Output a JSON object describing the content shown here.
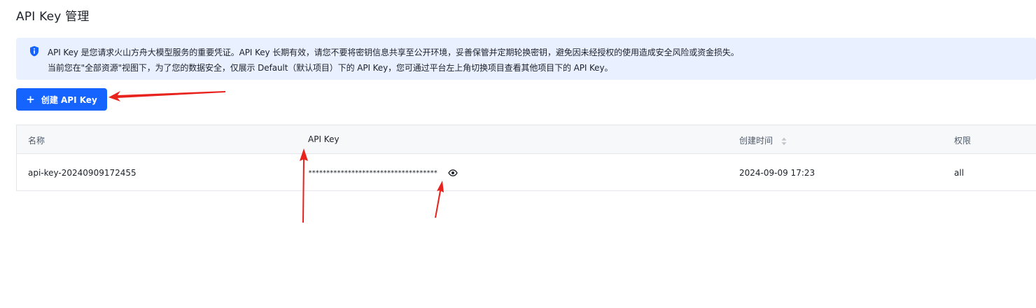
{
  "page": {
    "title": "API Key 管理"
  },
  "notice": {
    "icon": "shield-info-icon",
    "line1": "API Key 是您请求火山方舟大模型服务的重要凭证。API Key 长期有效，请您不要将密钥信息共享至公开环境，妥善保管并定期轮换密钥，避免因未经授权的使用造成安全风险或资金损失。",
    "line2": "当前您在\"全部资源\"视图下，为了您的数据安全，仅展示 Default（默认项目）下的 API Key，您可通过平台左上角切换项目查看其他项目下的 API Key。",
    "color": "#e9f0ff"
  },
  "toolbar": {
    "create_label": "创建 API Key",
    "create_icon": "plus-icon",
    "accent": "#1664ff"
  },
  "table": {
    "columns": [
      "名称",
      "API Key",
      "创建时间",
      "权限"
    ],
    "rows": [
      {
        "name": "api-key-20240909172455",
        "key": "************************************",
        "created": "2024-09-09 17:23",
        "permission": "all"
      }
    ]
  },
  "annotation_color": "#e8231e"
}
